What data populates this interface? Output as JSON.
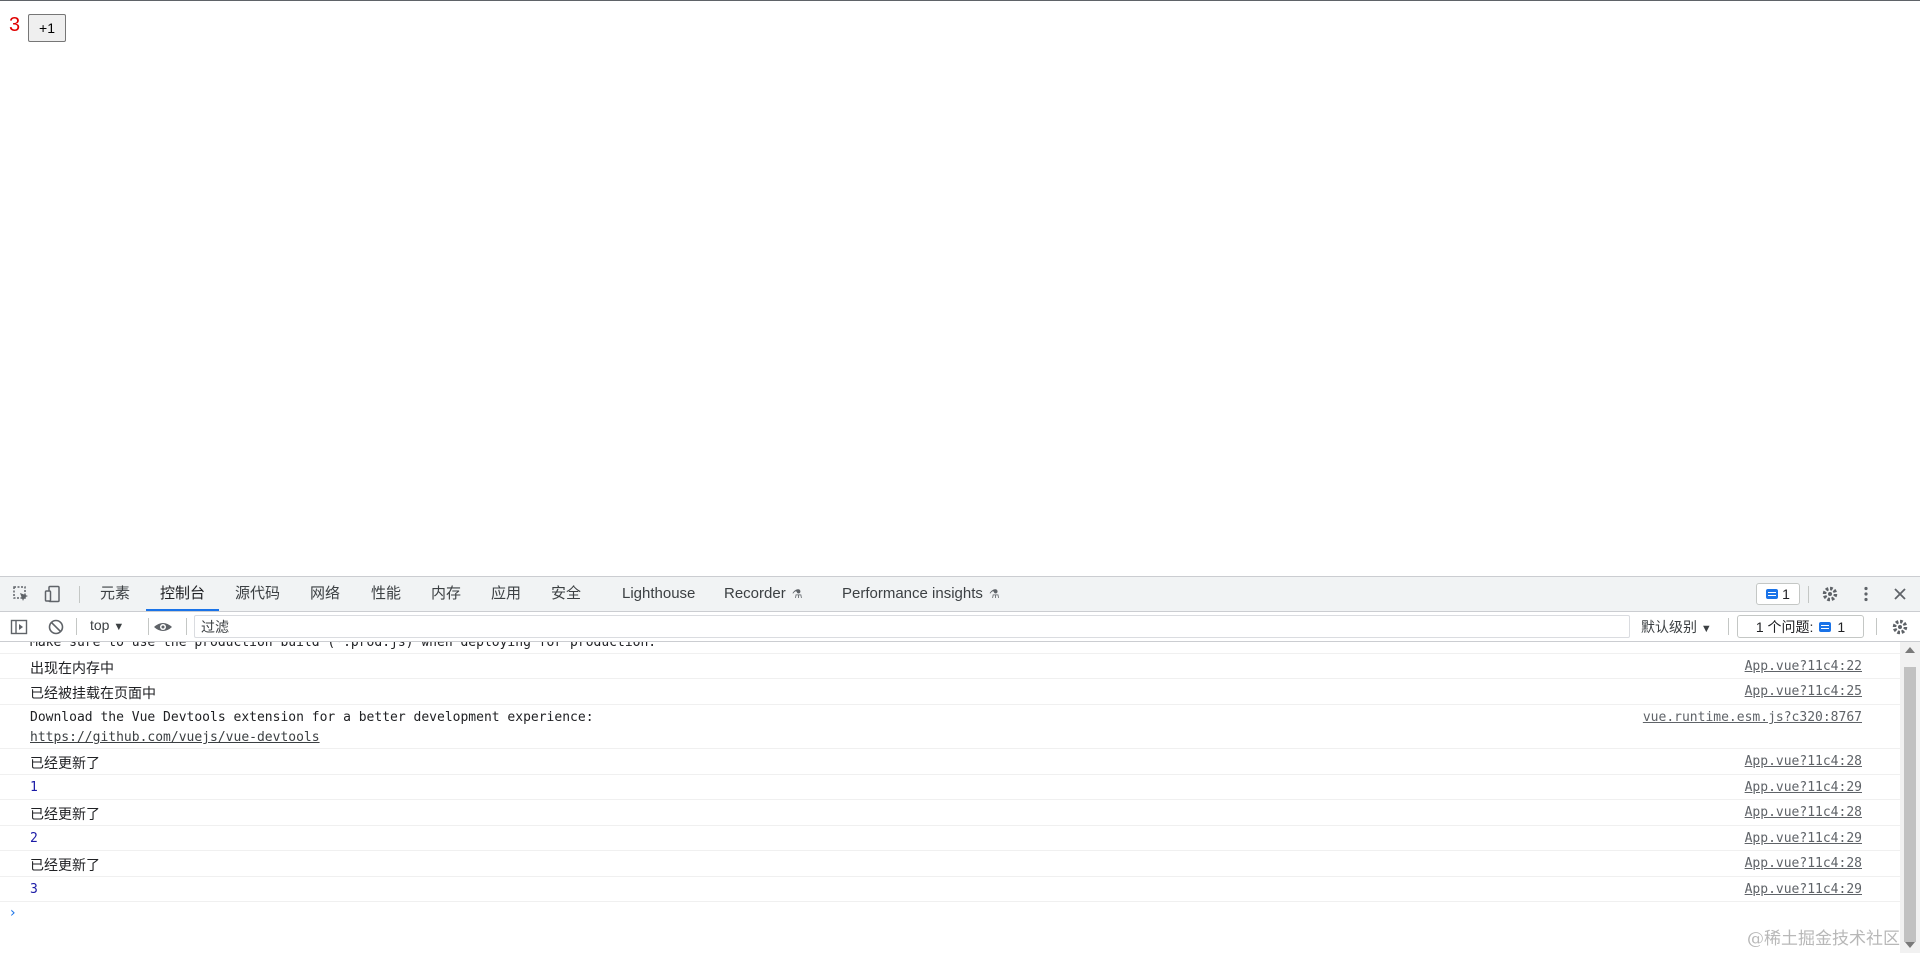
{
  "page": {
    "counter_value": "3",
    "increment_button": "+1"
  },
  "devtools": {
    "tabs": [
      {
        "label": "元素"
      },
      {
        "label": "控制台"
      },
      {
        "label": "源代码"
      },
      {
        "label": "网络"
      },
      {
        "label": "性能"
      },
      {
        "label": "内存"
      },
      {
        "label": "应用"
      },
      {
        "label": "安全"
      },
      {
        "label": "Lighthouse"
      },
      {
        "label": "Recorder"
      },
      {
        "label": "Performance insights"
      }
    ],
    "issues_badge_count": "1",
    "toolbar": {
      "context": "top",
      "filter_placeholder": "过滤",
      "level": "默认级别",
      "issues_label": "1 个问题:",
      "issues_count": "1"
    },
    "console": {
      "top_truncated": "Make sure to use the production build (*.prod.js) when deploying for production.",
      "messages": [
        {
          "text": "出现在内存中",
          "source": "App.vue?11c4:22"
        },
        {
          "text": "已经被挂载在页面中",
          "source": "App.vue?11c4:25"
        },
        {
          "text": "Download the Vue Devtools extension for a better development experience:",
          "link": "https://github.com/vuejs/vue-devtools",
          "source": "vue.runtime.esm.js?c320:8767"
        },
        {
          "text": "已经更新了",
          "source": "App.vue?11c4:28"
        },
        {
          "text": "1",
          "source": "App.vue?11c4:29"
        },
        {
          "text": "已经更新了",
          "source": "App.vue?11c4:28"
        },
        {
          "text": "2",
          "source": "App.vue?11c4:29"
        },
        {
          "text": "已经更新了",
          "source": "App.vue?11c4:28"
        },
        {
          "text": "3",
          "source": "App.vue?11c4:29"
        }
      ]
    },
    "watermark": "@稀土掘金技术社区"
  }
}
